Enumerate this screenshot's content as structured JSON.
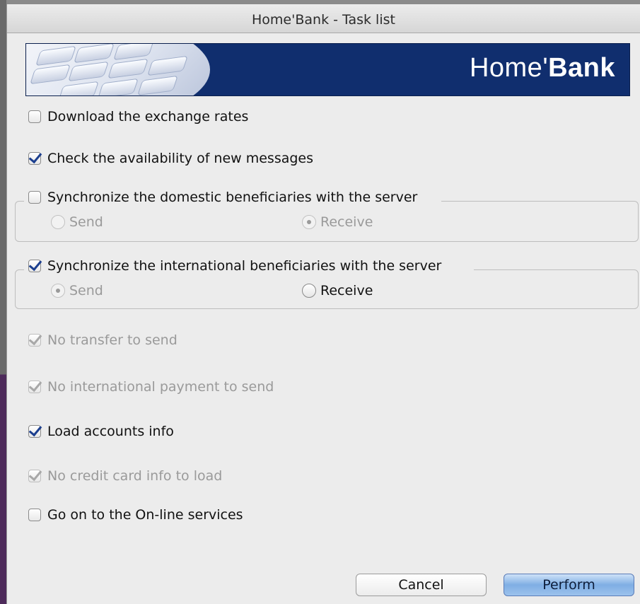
{
  "window": {
    "title": "Home'Bank - Task list"
  },
  "banner": {
    "logo_light": "Home'",
    "logo_bold": "Bank"
  },
  "tasks": [
    {
      "label": "Download the exchange rates",
      "checked": false,
      "enabled": true
    },
    {
      "label": "Check the availability of new messages",
      "checked": true,
      "enabled": true
    },
    {
      "label": "Synchronize the domestic beneficiaries with the server",
      "checked": false,
      "enabled": true
    },
    {
      "label": "Synchronize the international beneficiaries with the server",
      "checked": true,
      "enabled": true
    },
    {
      "label": "No transfer to send",
      "checked": true,
      "enabled": false
    },
    {
      "label": "No international payment to send",
      "checked": true,
      "enabled": false
    },
    {
      "label": "Load accounts info",
      "checked": true,
      "enabled": true
    },
    {
      "label": "No credit card info to load",
      "checked": true,
      "enabled": false
    },
    {
      "label": "Go on to the On-line services",
      "checked": false,
      "enabled": true
    }
  ],
  "domestic_group": {
    "send_label": "Send",
    "receive_label": "Receive",
    "selected": "Receive",
    "enabled": false
  },
  "international_group": {
    "send_label": "Send",
    "receive_label": "Receive",
    "selected": "Send",
    "send_enabled": false,
    "receive_enabled": true
  },
  "buttons": {
    "cancel": "Cancel",
    "perform": "Perform"
  },
  "colors": {
    "banner": "#102e6e",
    "check": "#1c3f8f",
    "default_button": "#7faee4"
  }
}
